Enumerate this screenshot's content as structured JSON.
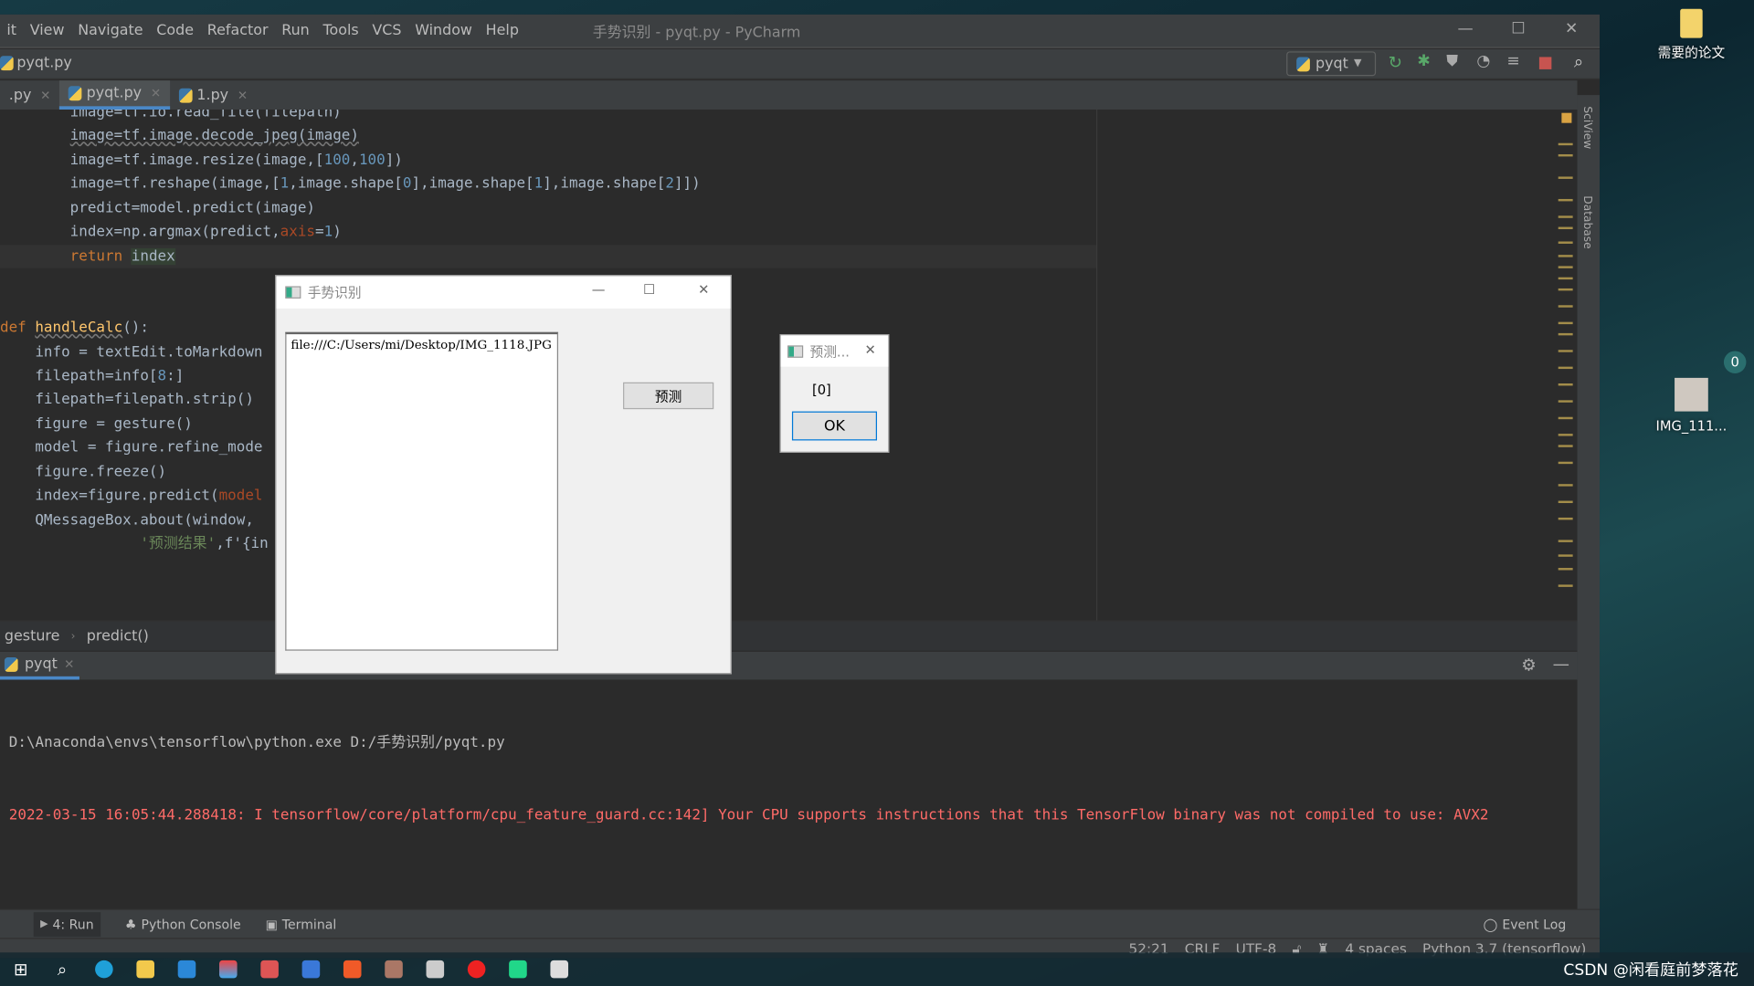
{
  "window": {
    "title": "手势识别 - pyqt.py - PyCharm"
  },
  "menu": [
    "it",
    "View",
    "Navigate",
    "Code",
    "Refactor",
    "Run",
    "Tools",
    "VCS",
    "Window",
    "Help"
  ],
  "navbar": {
    "file": "pyqt.py",
    "run_config": "pyqt"
  },
  "tabs": [
    {
      "label": ".py"
    },
    {
      "label": "pyqt.py",
      "active": true
    },
    {
      "label": "1.py"
    }
  ],
  "code": [
    [
      [
        "        image=tf.io.read_file(filepath)",
        ""
      ]
    ],
    [
      [
        "        ",
        ""
      ],
      [
        "image=tf.image.decode_jpeg(image)",
        "sq"
      ]
    ],
    [
      [
        "        image=tf.image.resize(image,[",
        ""
      ],
      [
        "100",
        "num"
      ],
      [
        ",",
        ""
      ],
      [
        "100",
        "num"
      ],
      [
        "])",
        ""
      ]
    ],
    [
      [
        "        image=tf.reshape(image,[",
        ""
      ],
      [
        "1",
        "num"
      ],
      [
        ",image.shape[",
        ""
      ],
      [
        "0",
        "num"
      ],
      [
        "],image.shape[",
        ""
      ],
      [
        "1",
        "num"
      ],
      [
        "],image.shape[",
        ""
      ],
      [
        "2",
        "num"
      ],
      [
        "]])",
        ""
      ]
    ],
    [
      [
        "        predict=model.predict(image)",
        ""
      ]
    ],
    [
      [
        "        index=np.argmax(predict,",
        ""
      ],
      [
        "axis",
        "param"
      ],
      [
        "=",
        ""
      ],
      [
        "1",
        "num"
      ],
      [
        ")",
        ""
      ]
    ],
    [
      [
        "        ",
        ""
      ],
      [
        "return",
        "kw"
      ],
      [
        " ",
        ""
      ],
      [
        "index",
        "hl"
      ]
    ],
    [],
    [],
    [
      [
        "def",
        "kw"
      ],
      [
        " ",
        ""
      ],
      [
        "handleCalc",
        "fn"
      ],
      [
        "():",
        ""
      ]
    ],
    [
      [
        "    info = textEdit.toMarkdown",
        ""
      ]
    ],
    [
      [
        "    filepath=info[",
        ""
      ],
      [
        "8",
        "num"
      ],
      [
        ":]",
        ""
      ]
    ],
    [
      [
        "    filepath=filepath.strip()",
        ""
      ]
    ],
    [
      [
        "    figure = gesture()",
        ""
      ]
    ],
    [
      [
        "    model = figure.refine_mode",
        ""
      ]
    ],
    [
      [
        "    figure.freeze()",
        ""
      ]
    ],
    [
      [
        "    index=figure.predict(",
        ""
      ],
      [
        "model",
        "param"
      ]
    ],
    [
      [
        "    QMessageBox.about(window,",
        ""
      ]
    ],
    [
      [
        "                ",
        ""
      ],
      [
        "'预测结果'",
        "str"
      ],
      [
        ",f'{in",
        ""
      ]
    ]
  ],
  "breadcrumb": [
    "gesture",
    "predict()"
  ],
  "run": {
    "tab": "pyqt",
    "lines": [
      {
        "text": "D:\\Anaconda\\envs\\tensorflow\\python.exe D:/手势识别/pyqt.py",
        "color": "#bbbbbb"
      },
      {
        "text": "2022-03-15 16:05:44.288418: I tensorflow/core/platform/cpu_feature_guard.cc:142] Your CPU supports instructions that this TensorFlow binary was not compiled to use: AVX2",
        "color": "#ff6b68"
      }
    ]
  },
  "toolwindows": {
    "run": "4: Run",
    "console": "Python Console",
    "terminal": "Terminal",
    "event_log": "Event Log"
  },
  "status": {
    "position": "52:21",
    "line_sep": "CRLF",
    "encoding": "UTF-8",
    "indent": "4 spaces",
    "interpreter": "Python 3.7 (tensorflow)"
  },
  "sideTabs": {
    "sciview": "SciView",
    "database": "Database"
  },
  "qtWindow": {
    "title": "手势识别",
    "text": "file:///C:/Users/mi/Desktop/IMG_1118.JPG",
    "button": "预测"
  },
  "msgBox": {
    "title": "预测...",
    "message": "[0]",
    "ok": "OK"
  },
  "desktop": {
    "folder": "需要的论文",
    "image": "IMG_111...",
    "badge": "0"
  },
  "watermark": "CSDN @闲看庭前梦落花"
}
